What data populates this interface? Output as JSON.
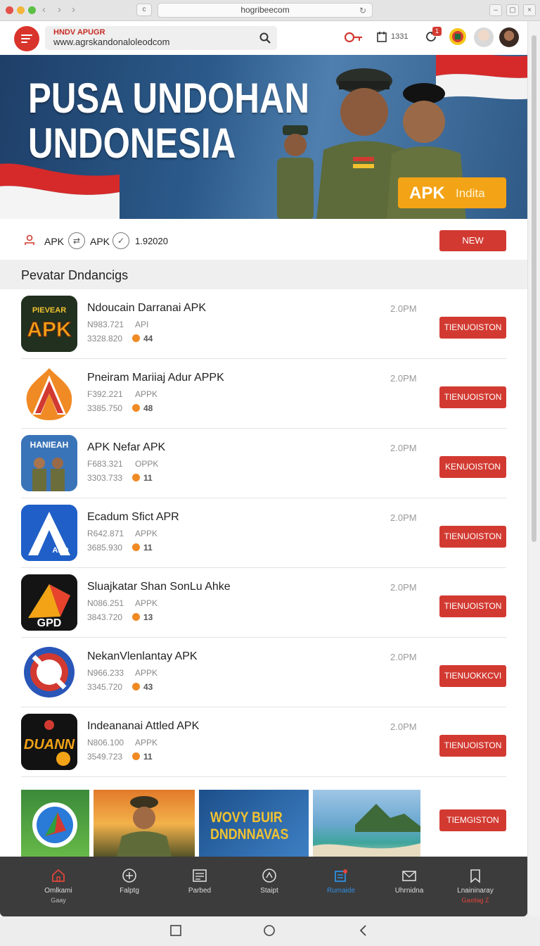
{
  "browser": {
    "url": "hogribeecom",
    "tab_icon": "c"
  },
  "header": {
    "brand": "HNDV APUGR",
    "search_text": "www.agrskandonaloleodcom",
    "counter": "1331",
    "notif_badge": "1"
  },
  "banner": {
    "title_line1": "PUSA UNDOHAN",
    "title_line2": "UNDONESIA",
    "badge_a": "APK",
    "badge_b": "Indita"
  },
  "info_row": {
    "item1": "APK",
    "item2": "APK",
    "item3": "1.92020",
    "new_button": "NEW"
  },
  "section": {
    "title": "Pevatar Dndancigs"
  },
  "apps": [
    {
      "name": "Ndoucain Darranai APK",
      "meta1": "N983.721",
      "meta1b": "API",
      "meta2": "3328.820",
      "rating": "44",
      "time": "2.0PM",
      "button": "TIENUOISTON",
      "icon_text": "APK",
      "icon_top": "PIEVEAR"
    },
    {
      "name": "Pneiram Mariiaj Adur APPK",
      "meta1": "F392.221",
      "meta1b": "APPK",
      "meta2": "3385.750",
      "rating": "48",
      "time": "2.0PM",
      "button": "TIENUOISTON",
      "icon_text": "A"
    },
    {
      "name": "APK Nefar APK",
      "meta1": "F683.321",
      "meta1b": "OPPK",
      "meta2": "3303.733",
      "rating": "11",
      "time": "2.0PM",
      "button": "KENUOISTON",
      "icon_text": "HANIEAH"
    },
    {
      "name": "Ecadum Sfict APR",
      "meta1": "R642.871",
      "meta1b": "APPK",
      "meta2": "3685.930",
      "rating": "11",
      "time": "2.0PM",
      "button": "TIENUOISTON",
      "icon_text": "APD"
    },
    {
      "name": "Sluajkatar Shan SonLu Ahke",
      "meta1": "N086.251",
      "meta1b": "APPK",
      "meta2": "3843.720",
      "rating": "13",
      "time": "2.0PM",
      "button": "TIENUOISTON",
      "icon_text": "GPD"
    },
    {
      "name": "NekanVlenlantay APK",
      "meta1": "N966.233",
      "meta1b": "APPK",
      "meta2": "3345.720",
      "rating": "43",
      "time": "2.0PM",
      "button": "TIENUOKKCVI",
      "icon_text": ""
    },
    {
      "name": "Indeananai Attled APK",
      "meta1": "N806.100",
      "meta1b": "APPK",
      "meta2": "3549.723",
      "rating": "11",
      "time": "2.0PM",
      "button": "TIENUOISTON",
      "icon_text": "DUANN"
    }
  ],
  "gallery": {
    "banner_line1": "WOVY BUIR",
    "banner_line2": "DNDNNAVAS",
    "button": "TIEMGISTON"
  },
  "bottom_nav": [
    {
      "label": "Omlkami",
      "sub": "Gaay"
    },
    {
      "label": "Falptg",
      "sub": ""
    },
    {
      "label": "Parbed",
      "sub": ""
    },
    {
      "label": "Staipt",
      "sub": ""
    },
    {
      "label": "Rumaide",
      "sub": ""
    },
    {
      "label": "Uhrnidna",
      "sub": ""
    },
    {
      "label": "Lnaininaray",
      "sub": "Gaxtlag Z"
    }
  ],
  "colors": {
    "accent_red": "#d23a31",
    "nav_active": "#2f8fe0",
    "banner_badge": "#f2a316"
  }
}
